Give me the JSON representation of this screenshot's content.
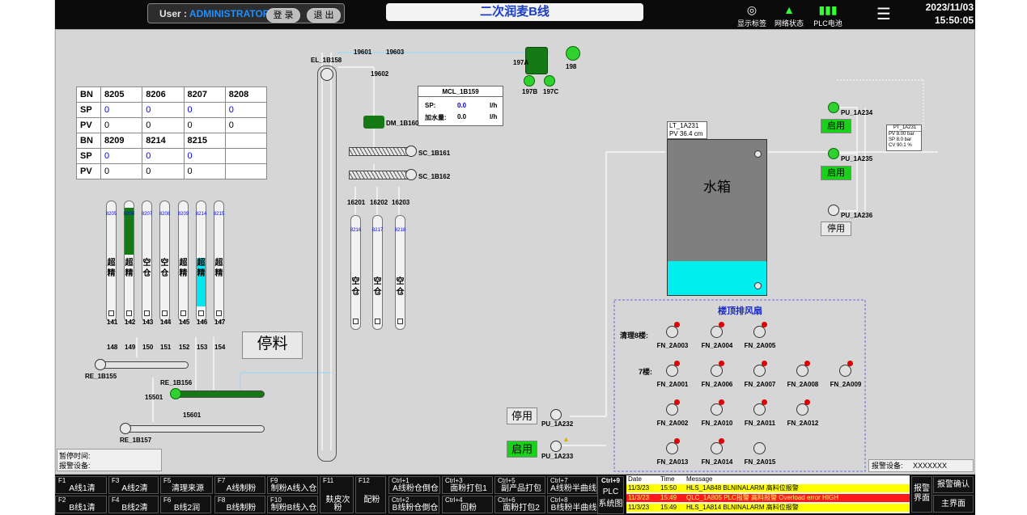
{
  "header": {
    "user_prefix": "User : ",
    "user_name": "ADMINISTRATOR",
    "login_label": "登 录",
    "logout_label": "退 出",
    "title": "二次润麦B线",
    "icons": [
      {
        "label": "显示标签",
        "icon": "display-tag-icon"
      },
      {
        "label": "网络状态",
        "icon": "network-status-icon"
      },
      {
        "label": "PLC电池",
        "icon": "plc-battery-icon"
      }
    ],
    "menu_icon": "hamburger-menu-icon",
    "date": "2023/11/03",
    "time": "15:50:05"
  },
  "bn_table": {
    "rows1": {
      "head": [
        "BN",
        "8205",
        "8206",
        "8207",
        "8208"
      ],
      "sp": [
        "SP",
        "0",
        "0",
        "0",
        "0"
      ],
      "pv": [
        "PV",
        "0",
        "0",
        "0",
        "0"
      ]
    },
    "rows2": {
      "head": [
        "BN",
        "8209",
        "8214",
        "8215",
        ""
      ],
      "sp": [
        "SP",
        "0",
        "0",
        "0",
        ""
      ],
      "pv": [
        "PV",
        "0",
        "0",
        "0",
        ""
      ]
    }
  },
  "bins_left": [
    {
      "num": "8205",
      "text": "超精",
      "fill": "none",
      "gate": "141",
      "valve": "148"
    },
    {
      "num": "8206",
      "text": "超精",
      "fill": "green",
      "gate": "142",
      "valve": "149"
    },
    {
      "num": "8207",
      "text": "空仓",
      "fill": "none",
      "gate": "143",
      "valve": "150"
    },
    {
      "num": "8208",
      "text": "空仓",
      "fill": "none",
      "gate": "144",
      "valve": "151"
    },
    {
      "num": "8209",
      "text": "超精",
      "fill": "none",
      "gate": "145",
      "valve": "152"
    },
    {
      "num": "8214",
      "text": "超精",
      "fill": "cyan",
      "gate": "146",
      "valve": "153"
    },
    {
      "num": "8215",
      "text": "超精",
      "fill": "none",
      "gate": "147",
      "valve": "154"
    }
  ],
  "bins_mid": [
    {
      "num": "8216",
      "text": "空仓",
      "gate": "16201"
    },
    {
      "num": "8217",
      "text": "空仓",
      "gate": "16202"
    },
    {
      "num": "8218",
      "text": "空仓",
      "gate": "16203"
    }
  ],
  "equipment": {
    "elevator": "EL_1B158",
    "gates_top": [
      "19601",
      "19603",
      "19602"
    ],
    "blower_a": "197A",
    "blower_b": "197B",
    "blower_c": "197C",
    "fan_198": "198",
    "dm": "DM_1B160",
    "sc1": "SC_1B161",
    "sc2": "SC_1B162",
    "re155": "RE_1B155",
    "re156": "RE_1B156",
    "re157": "RE_1B157",
    "gate_15501": "15501",
    "gate_15601": "15601",
    "stop_feed": "停料"
  },
  "mcl": {
    "title": "MCL_1B159",
    "sp_label": "SP:",
    "sp_value": "0.0",
    "sp_unit": "l/h",
    "add_label": "加水量:",
    "add_value": "0.0",
    "add_unit": "l/h"
  },
  "tank": {
    "lt_tag": "LT_1A231",
    "pv_label": "PV",
    "pv_value": "36.4",
    "pv_unit": "cm",
    "label": "水箱",
    "level_pct": 22
  },
  "pumps": [
    {
      "tag": "PU_1A234",
      "button": "启用",
      "state": "on"
    },
    {
      "tag": "PU_1A235",
      "button": "启用",
      "state": "on"
    },
    {
      "tag": "PU_1A236",
      "button": "停用",
      "state": "off"
    },
    {
      "tag": "PU_1A232",
      "button": "停用",
      "state": "off"
    },
    {
      "tag": "PU_1A233",
      "button": "启用",
      "state": "on"
    }
  ],
  "pt": {
    "tag": "PT_1A231",
    "pv_label": "PV",
    "pv_value": "8.00",
    "pv_unit": "bar",
    "sp_label": "SP",
    "sp_value": "8.0",
    "sp_unit": "bar",
    "cv_label": "CV",
    "cv_value": "90.1",
    "cv_unit": "%"
  },
  "fan_section": {
    "title": "楼顶排风扇",
    "floor8": "清理8楼:",
    "floor7": "7楼:",
    "fans": [
      [
        "FN_2A003",
        "FN_2A004",
        "FN_2A005"
      ],
      [
        "FN_2A001",
        "FN_2A006",
        "FN_2A007",
        "FN_2A008",
        "FN_2A009"
      ],
      [
        "FN_2A002",
        "FN_2A010",
        "FN_2A011",
        "FN_2A012"
      ],
      [
        "FN_2A013",
        "FN_2A014",
        "FN_2A015"
      ]
    ]
  },
  "pause_box": {
    "line1": "暂停时间:",
    "line2": "报警设备:"
  },
  "alarm_device": {
    "label": "报警设备:",
    "value": "XXXXXXX"
  },
  "fkeys": [
    {
      "key": "F1",
      "label": "A线1清"
    },
    {
      "key": "F3",
      "label": "A线2清"
    },
    {
      "key": "F5",
      "label": "清理来源"
    },
    {
      "key": "F7",
      "label": "A线制粉"
    },
    {
      "key": "F9",
      "label": "制粉A线入仓"
    },
    {
      "key": "F11",
      "label": "麸皮次粉"
    },
    {
      "key": "F12",
      "label": "配粉"
    },
    {
      "key": "Ctrl+1",
      "label": "A线粉仓倒仓"
    },
    {
      "key": "Ctrl+3",
      "label": "面粉打包1"
    },
    {
      "key": "Ctrl+5",
      "label": "副产品打包"
    },
    {
      "key": "Ctrl+7",
      "label": "A线粉半曲线"
    },
    {
      "key": "F2",
      "label": "B线1清"
    },
    {
      "key": "F4",
      "label": "B线2清"
    },
    {
      "key": "F6",
      "label": "B线2润"
    },
    {
      "key": "F8",
      "label": "B线制粉"
    },
    {
      "key": "F10",
      "label": "制粉B线入仓"
    },
    {
      "key": "Ctrl+2",
      "label": "B线粉仓倒仓"
    },
    {
      "key": "Ctrl+4",
      "label": "回粉"
    },
    {
      "key": "Ctrl+6",
      "label": "面粉打包2"
    },
    {
      "key": "Ctrl+8",
      "label": "B线粉半曲线"
    }
  ],
  "ctrl9": {
    "key": "Ctrl+9",
    "line1": "PLC",
    "line2": "系统图"
  },
  "alarm_table": {
    "headers": [
      "Date",
      "Time",
      "Message"
    ],
    "rows": [
      {
        "date": "11/3/23",
        "time": "15:50",
        "msg": "HLS_1A848 BLNINALARM 高料位报警",
        "color": "#ffff00",
        "fg": "#000000"
      },
      {
        "date": "11/3/23",
        "time": "15:49",
        "msg": "QLC_1A805 PLC报警 高料报警 Overload error HIGH",
        "color": "#ff1a1a",
        "fg": "#ffff66"
      },
      {
        "date": "11/3/23",
        "time": "15:49",
        "msg": "HLS_1A814 BLNINALARM 高料位报警",
        "color": "#ffff00",
        "fg": "#000000"
      }
    ]
  },
  "right_buttons": {
    "alarm_view": "报警界面",
    "alarm_confirm": "报警确认",
    "main_view": "主界面"
  }
}
